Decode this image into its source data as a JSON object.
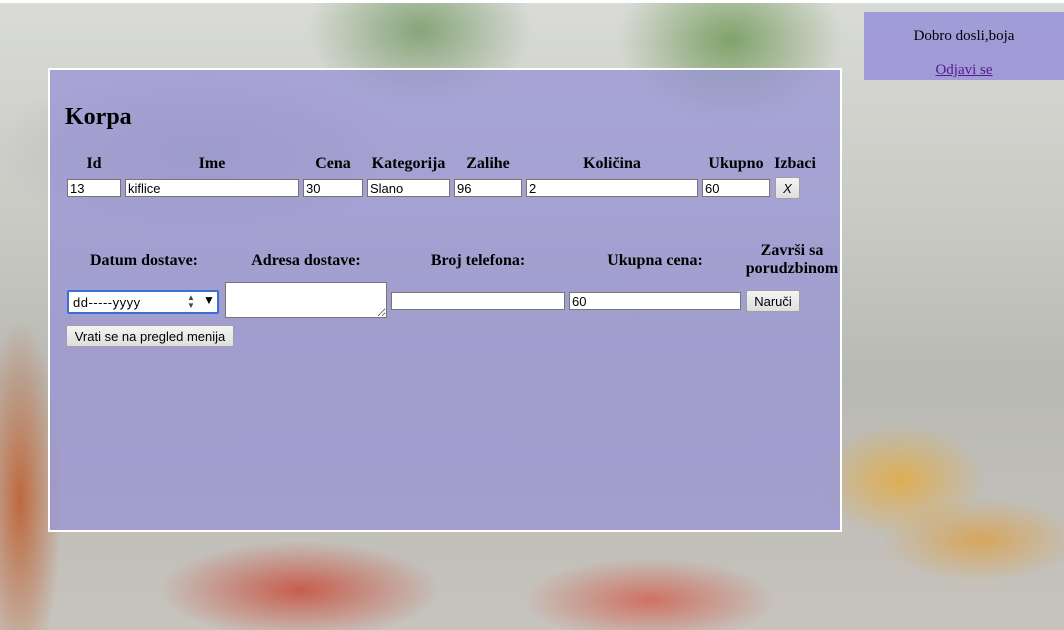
{
  "welcome": {
    "text": "Dobro dosli,boja",
    "logout": "Odjavi se"
  },
  "cart": {
    "title": "Korpa",
    "columns": [
      "Id",
      "Ime",
      "Cena",
      "Kategorija",
      "Zalihe",
      "Količina",
      "Ukupno",
      "Izbaci"
    ],
    "row": {
      "id": "13",
      "ime": "kiflice",
      "cena": "30",
      "kategorija": "Slano",
      "zalihe": "96",
      "kolicina": "2",
      "ukupno": "60",
      "izbaci": "X"
    }
  },
  "order": {
    "datum_label": "Datum dostave:",
    "adresa_label": "Adresa dostave:",
    "telefon_label": "Broj telefona:",
    "ukupna_label": "Ukupna cena:",
    "zavrsi_label_line1": "Završi sa",
    "zavrsi_label_line2": "porudzbinom",
    "date_placeholder": "dd-----yyyy",
    "adresa_value": "",
    "telefon_value": "",
    "ukupna_value": "60",
    "naruci_button": "Naruči"
  },
  "back_button": "Vrati se na pregled menija",
  "colors": {
    "panel": "#9691d7",
    "panel_border": "#ffffff",
    "link": "#551a8b",
    "focus": "#3b6fd6"
  }
}
